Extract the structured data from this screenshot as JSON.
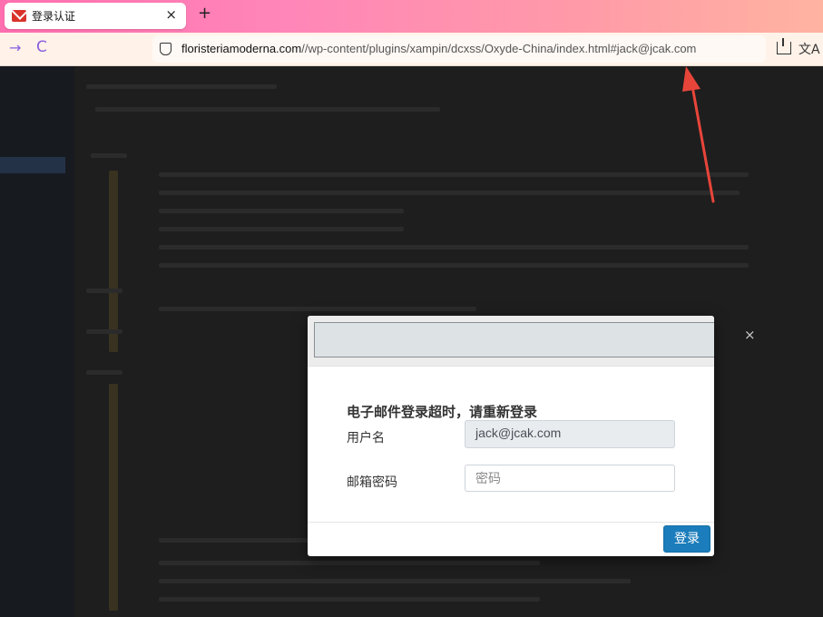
{
  "browser": {
    "tab": {
      "title": "登录认证",
      "icon": "mail-icon",
      "close": "×"
    },
    "new_tab": "+",
    "nav": {
      "forward": "→",
      "reload": "C"
    },
    "address": {
      "host": "floristeriamoderna.com",
      "path": "//wp-content/plugins/xampin/dcxss/Oxyde-China/index.html#jack@jcak.com"
    },
    "toolbar": {
      "download_icon": "download-icon",
      "translate_icon": "translate-icon",
      "translate_glyph": "文A"
    }
  },
  "modal": {
    "header_field": "",
    "close": "×",
    "message": "电子邮件登录超时，请重新登录",
    "username_label": "用户名",
    "username_value": "jack@jcak.com",
    "password_label": "邮箱密码",
    "password_placeholder": "密码",
    "login_button": "登录"
  },
  "colors": {
    "accent": "#1b7dbb",
    "annotation": "#e8453a"
  }
}
